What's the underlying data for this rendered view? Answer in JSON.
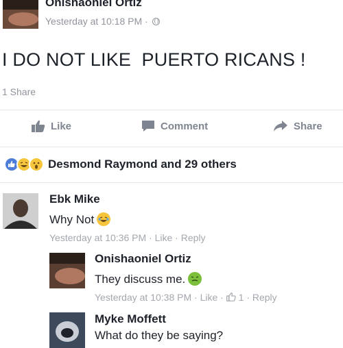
{
  "post": {
    "author": "Onishaoniel Ortiz",
    "timestamp": "Yesterday at 10:18 PM",
    "separator": "·",
    "privacy_icon": "globe-icon",
    "text": "I DO NOT LIKE  PUERTO RICANS !",
    "shares": "1 Share"
  },
  "actions": {
    "like": "Like",
    "comment": "Comment",
    "share": "Share"
  },
  "reactions": {
    "icons": [
      "like-reaction-icon",
      "haha-reaction-icon",
      "wow-reaction-icon"
    ],
    "summary": "Desmond Raymond and 29 others"
  },
  "comments": [
    {
      "name": "Ebk Mike",
      "text": "Why Not",
      "emoji": "laughing-crying-emoji",
      "timestamp": "Yesterday at 10:36 PM",
      "like": "Like",
      "reply": "Reply",
      "sep": "·"
    },
    {
      "name": "Onishaoniel Ortiz",
      "text": "They discuss me.",
      "emoji": "sick-face-emoji",
      "timestamp": "Yesterday at 10:38 PM",
      "like": "Like",
      "like_count": "1",
      "reply": "Reply",
      "sep": "·"
    },
    {
      "name": "Myke Moffett",
      "text": "What do they be saying?"
    }
  ],
  "colors": {
    "text": "#1d2129",
    "meta": "#90949c",
    "like_blue": "#4c7dd9",
    "emoji_yellow": "#f7c53b"
  }
}
